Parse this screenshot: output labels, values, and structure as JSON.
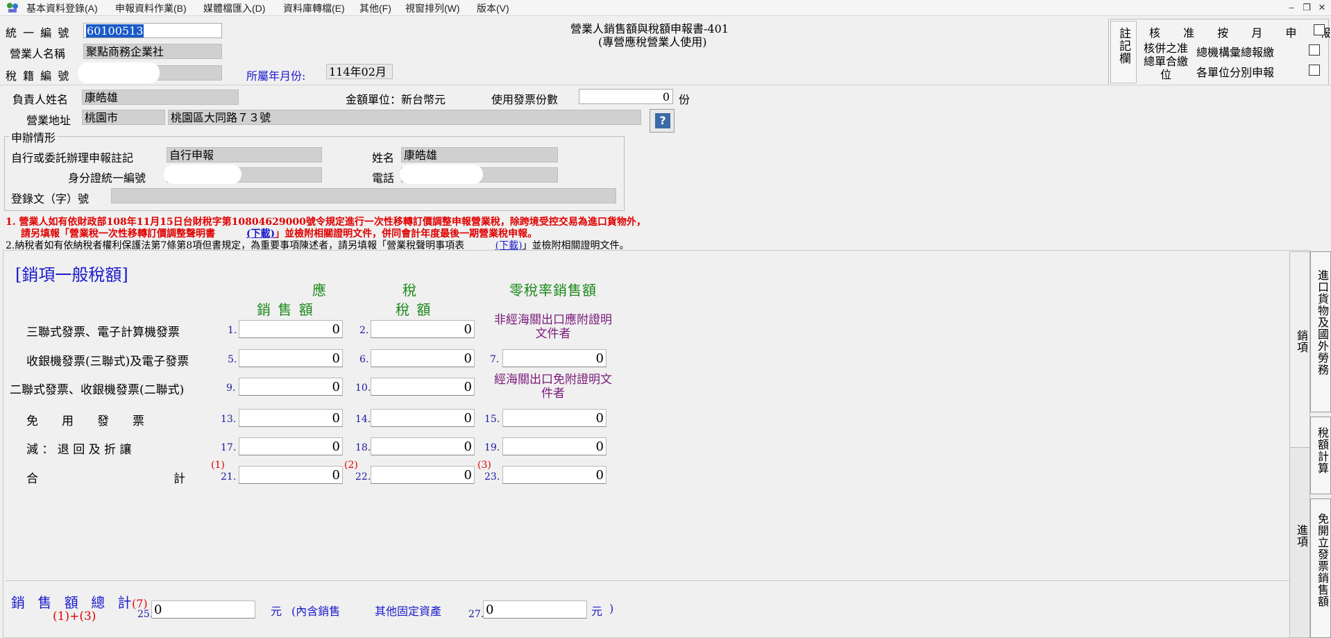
{
  "menu": [
    "基本資料登錄(A)",
    "申報資料作業(B)",
    "媒體檔匯入(D)",
    "資料庫轉檔(E)",
    "其他(F)",
    "視窗排列(W)",
    "版本(V)"
  ],
  "window_controls": [
    "–",
    "❐",
    "✕"
  ],
  "header": {
    "unified_no_label": "統 一 編 號",
    "unified_no_value": "60100513",
    "company_name_label": "營業人名稱",
    "company_name_value": "聚點商務企業社",
    "tax_id_label": "稅 籍 編 號",
    "period_label": "所屬年月份:",
    "period_value": "114年02月",
    "title_line1": "營業人銷售額與稅額申報書-401",
    "title_line2": "(專營應稅營業人使用)",
    "remark_label": "註記欄",
    "approve_monthly": "核 准 按 月 申 報",
    "combined_label": "核併之准總單合繳位",
    "head_office_total": "總機構彙總報繳",
    "each_unit": "各單位分別申報"
  },
  "info": {
    "responsible_label": "負責人姓名",
    "responsible_value": "康皓雄",
    "currency_label": "金額單位：新台幣元",
    "invoice_count_label": "使用發票份數",
    "invoice_count_value": "0",
    "invoice_count_unit": "份",
    "address_label": "營業地址",
    "city_value": "桃園市",
    "address_value": "桃園區大同路７３號",
    "help_icon": "?",
    "filing_group_label": "申辦情形",
    "self_or_agent_label": "自行或委託辦理申報註記",
    "self_or_agent_value": "自行申報",
    "name_label": "姓名",
    "name_value": "康皓雄",
    "id_label": "身分證統一編號",
    "phone_label": "電話",
    "reg_no_label": "登錄文（字）號"
  },
  "notes": {
    "note1_line1": "1. 營業人如有依財政部108年11月15日台財稅字第10804629000號令規定進行一次性移轉訂價調整申報營業稅，除跨境受控交易為進口貨物外，",
    "note1_line2": "請另填報「營業稅一次性移轉訂價調整聲明書",
    "note1_link": "(下載)",
    "note1_tail": "」並檢附相關證明文件，併同會計年度最後一期營業稅申報。",
    "note2_text": "2.納稅者如有依納稅者權利保護法第7條第8項但書規定，為重要事項陳述者，請另填報「營業稅聲明事項表",
    "note2_link": "(下載)",
    "note2_tail": "」並檢附相關證明文件。"
  },
  "sales": {
    "section_title": "[銷項一般稅額]",
    "head_taxable_1": "應",
    "head_taxable_2": "稅",
    "head_sales": "銷 售 額",
    "head_tax": "稅 額",
    "head_zero": "零稅率銷售額",
    "zero_note1": "非經海關出口應附證明文件者",
    "zero_note2": "經海關出口免附證明文件者",
    "rows": [
      {
        "label": "三聯式發票、電子計算機發票",
        "i1": "1.",
        "v1": "0",
        "i2": "2.",
        "v2": "0",
        "i3": "",
        "v3": ""
      },
      {
        "label": "收銀機發票(三聯式)及電子發票",
        "i1": "5.",
        "v1": "0",
        "i2": "6.",
        "v2": "0",
        "i3": "7.",
        "v3": "0"
      },
      {
        "label": "二聯式發票、收銀機發票(二聯式)",
        "i1": "9.",
        "v1": "0",
        "i2": "10.",
        "v2": "0",
        "i3": "",
        "v3": ""
      },
      {
        "label": "免　　用　　發　　票",
        "i1": "13.",
        "v1": "0",
        "i2": "14.",
        "v2": "0",
        "i3": "15.",
        "v3": "0"
      },
      {
        "label": "減 ： 退 回 及 折 讓",
        "i1": "17.",
        "v1": "0",
        "i2": "18.",
        "v2": "0",
        "i3": "19.",
        "v3": "0"
      },
      {
        "label_a": "合",
        "label_b": "計",
        "i1": "21.",
        "v1": "0",
        "i2": "22.",
        "v2": "0",
        "i3": "23.",
        "v3": "0"
      }
    ],
    "total_markers": [
      "(1)",
      "(2)",
      "(3)"
    ]
  },
  "summary": {
    "total_label": "銷 售 額 總 計",
    "marker": "(7)",
    "formula": "(1)+(3)",
    "i25": "25.",
    "v25": "0",
    "unit1": "元",
    "paren_text": "(內含銷售",
    "fixed_assets": "其他固定資產",
    "i27": "27.",
    "v27": "0",
    "unit2": "元",
    "close_paren": ")"
  },
  "side_tabs": {
    "tab_sales": "銷項",
    "tab_purchase": "進項",
    "tab_import": "進口貨物及國外勞務",
    "tab_tax_calc": "稅額計算",
    "tab_exempt": "免開立發票銷售額"
  }
}
